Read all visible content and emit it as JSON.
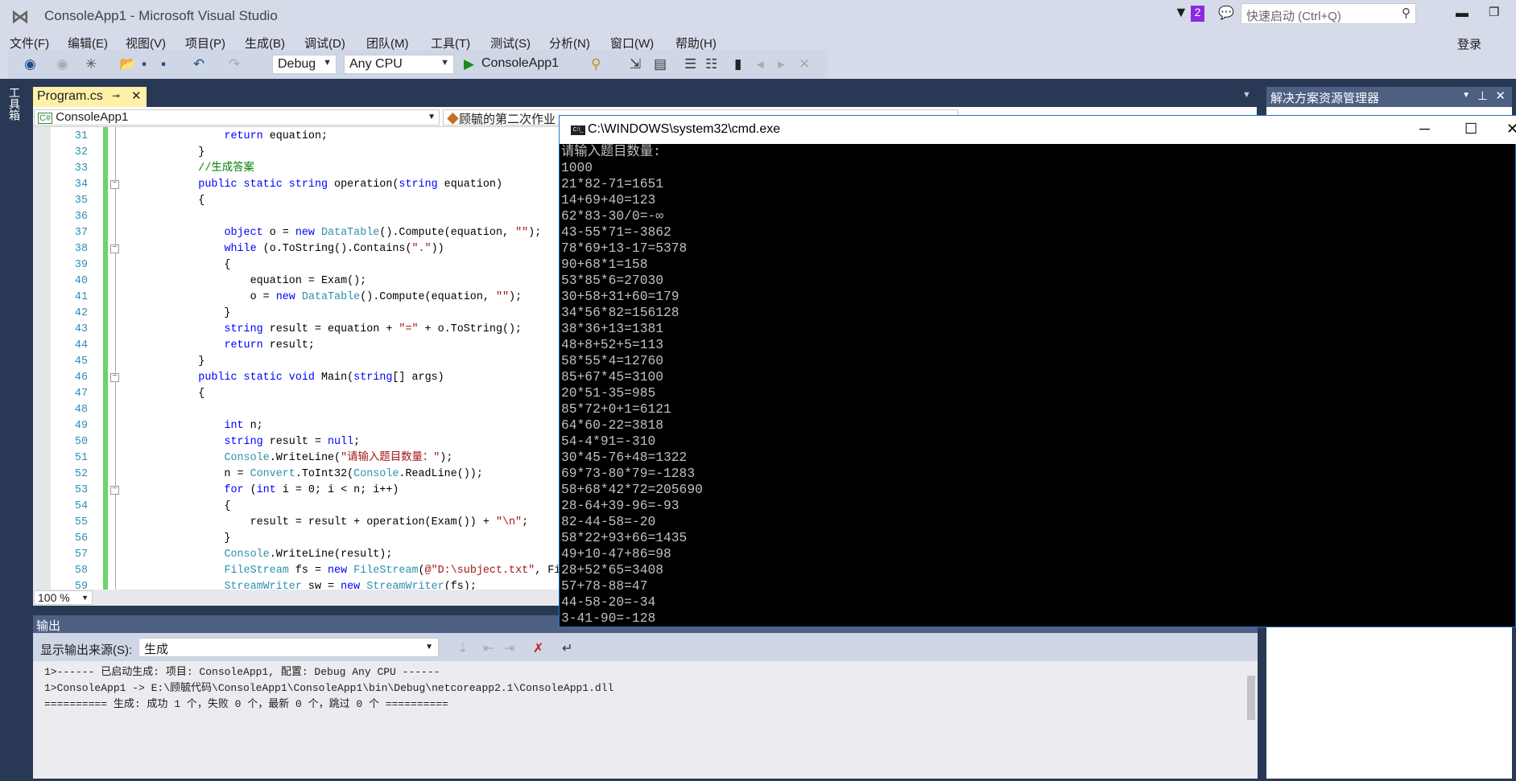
{
  "window": {
    "title": "ConsoleApp1 - Microsoft Visual Studio",
    "notification_count": "2",
    "quick_launch_placeholder": "快速启动 (Ctrl+Q)",
    "sign_in": "登录"
  },
  "menu": [
    "文件(F)",
    "编辑(E)",
    "视图(V)",
    "项目(P)",
    "生成(B)",
    "调试(D)",
    "团队(M)",
    "工具(T)",
    "测试(S)",
    "分析(N)",
    "窗口(W)",
    "帮助(H)"
  ],
  "toolbar": {
    "config": "Debug",
    "platform": "Any CPU",
    "start_target": "ConsoleApp1"
  },
  "toolbox_label": "工具箱",
  "editor": {
    "tab": "Program.cs",
    "project_dropdown": "ConsoleApp1",
    "class_dropdown": "顾毓的第二次作业",
    "zoom": "100 %",
    "lines": [
      {
        "n": "31",
        "t": [
          [
            "            ",
            "tx"
          ],
          [
            "return",
            "kw"
          ],
          [
            " equation;",
            "tx"
          ]
        ]
      },
      {
        "n": "32",
        "t": [
          [
            "        }",
            "tx"
          ]
        ]
      },
      {
        "n": "33",
        "t": [
          [
            "        //生成答案",
            "cm"
          ]
        ]
      },
      {
        "n": "34",
        "fold": true,
        "t": [
          [
            "        ",
            "tx"
          ],
          [
            "public static string",
            "kw"
          ],
          [
            " operation(",
            "tx"
          ],
          [
            "string",
            "kw"
          ],
          [
            " equation)",
            "tx"
          ]
        ]
      },
      {
        "n": "35",
        "t": [
          [
            "        {",
            "tx"
          ]
        ]
      },
      {
        "n": "36",
        "t": []
      },
      {
        "n": "37",
        "t": [
          [
            "            ",
            "tx"
          ],
          [
            "object",
            "kw"
          ],
          [
            " o = ",
            "tx"
          ],
          [
            "new",
            "kw"
          ],
          [
            " ",
            "tx"
          ],
          [
            "DataTable",
            "ty"
          ],
          [
            "().Compute(equation, ",
            "tx"
          ],
          [
            "\"\"",
            "st"
          ],
          [
            ");",
            "tx"
          ]
        ]
      },
      {
        "n": "38",
        "fold": true,
        "t": [
          [
            "            ",
            "tx"
          ],
          [
            "while",
            "kw"
          ],
          [
            " (o.ToString().Contains(",
            "tx"
          ],
          [
            "\".\"",
            "st"
          ],
          [
            "))",
            "tx"
          ]
        ]
      },
      {
        "n": "39",
        "t": [
          [
            "            {",
            "tx"
          ]
        ]
      },
      {
        "n": "40",
        "t": [
          [
            "                equation = Exam();",
            "tx"
          ]
        ]
      },
      {
        "n": "41",
        "t": [
          [
            "                o = ",
            "tx"
          ],
          [
            "new",
            "kw"
          ],
          [
            " ",
            "tx"
          ],
          [
            "DataTable",
            "ty"
          ],
          [
            "().Compute(equation, ",
            "tx"
          ],
          [
            "\"\"",
            "st"
          ],
          [
            ");",
            "tx"
          ]
        ]
      },
      {
        "n": "42",
        "t": [
          [
            "            }",
            "tx"
          ]
        ]
      },
      {
        "n": "43",
        "t": [
          [
            "            ",
            "tx"
          ],
          [
            "string",
            "kw"
          ],
          [
            " result = equation + ",
            "tx"
          ],
          [
            "\"=\"",
            "st"
          ],
          [
            " + o.ToString();",
            "tx"
          ]
        ]
      },
      {
        "n": "44",
        "t": [
          [
            "            ",
            "tx"
          ],
          [
            "return",
            "kw"
          ],
          [
            " result;",
            "tx"
          ]
        ]
      },
      {
        "n": "45",
        "t": [
          [
            "        }",
            "tx"
          ]
        ]
      },
      {
        "n": "46",
        "fold": true,
        "t": [
          [
            "        ",
            "tx"
          ],
          [
            "public static void",
            "kw"
          ],
          [
            " Main(",
            "tx"
          ],
          [
            "string",
            "kw"
          ],
          [
            "[] args)",
            "tx"
          ]
        ]
      },
      {
        "n": "47",
        "t": [
          [
            "        {",
            "tx"
          ]
        ]
      },
      {
        "n": "48",
        "t": []
      },
      {
        "n": "49",
        "t": [
          [
            "            ",
            "tx"
          ],
          [
            "int",
            "kw"
          ],
          [
            " n;",
            "tx"
          ]
        ]
      },
      {
        "n": "50",
        "t": [
          [
            "            ",
            "tx"
          ],
          [
            "string",
            "kw"
          ],
          [
            " result = ",
            "tx"
          ],
          [
            "null",
            "kw"
          ],
          [
            ";",
            "tx"
          ]
        ]
      },
      {
        "n": "51",
        "t": [
          [
            "            ",
            "tx"
          ],
          [
            "Console",
            "ty"
          ],
          [
            ".WriteLine(",
            "tx"
          ],
          [
            "\"请输入题目数量：\"",
            "st"
          ],
          [
            ");",
            "tx"
          ]
        ]
      },
      {
        "n": "52",
        "t": [
          [
            "            n = ",
            "tx"
          ],
          [
            "Convert",
            "ty"
          ],
          [
            ".ToInt32(",
            "tx"
          ],
          [
            "Console",
            "ty"
          ],
          [
            ".ReadLine());",
            "tx"
          ]
        ]
      },
      {
        "n": "53",
        "fold": true,
        "t": [
          [
            "            ",
            "tx"
          ],
          [
            "for",
            "kw"
          ],
          [
            " (",
            "tx"
          ],
          [
            "int",
            "kw"
          ],
          [
            " i = 0; i < n; i++)",
            "tx"
          ]
        ]
      },
      {
        "n": "54",
        "t": [
          [
            "            {",
            "tx"
          ]
        ]
      },
      {
        "n": "55",
        "t": [
          [
            "                result = result + operation(Exam()) + ",
            "tx"
          ],
          [
            "\"\\n\"",
            "st"
          ],
          [
            ";",
            "tx"
          ]
        ]
      },
      {
        "n": "56",
        "t": [
          [
            "            }",
            "tx"
          ]
        ]
      },
      {
        "n": "57",
        "t": [
          [
            "            ",
            "tx"
          ],
          [
            "Console",
            "ty"
          ],
          [
            ".WriteLine(result);",
            "tx"
          ]
        ]
      },
      {
        "n": "58",
        "t": [
          [
            "            ",
            "tx"
          ],
          [
            "FileStream",
            "ty"
          ],
          [
            " fs = ",
            "tx"
          ],
          [
            "new",
            "kw"
          ],
          [
            " ",
            "tx"
          ],
          [
            "FileStream",
            "ty"
          ],
          [
            "(",
            "tx"
          ],
          [
            "@\"D:\\subject.txt\"",
            "st"
          ],
          [
            ", Fi",
            "tx"
          ]
        ]
      },
      {
        "n": "59",
        "t": [
          [
            "            ",
            "tx"
          ],
          [
            "StreamWriter",
            "ty"
          ],
          [
            " sw = ",
            "tx"
          ],
          [
            "new",
            "kw"
          ],
          [
            " ",
            "tx"
          ],
          [
            "StreamWriter",
            "ty"
          ],
          [
            "(fs);",
            "tx"
          ]
        ]
      }
    ]
  },
  "output": {
    "title": "输出",
    "source_label": "显示输出来源(S):",
    "source_value": "生成",
    "lines": [
      "1>------ 已启动生成: 项目: ConsoleApp1, 配置: Debug Any CPU ------",
      "1>ConsoleApp1 -> E:\\顾毓代码\\ConsoleApp1\\ConsoleApp1\\bin\\Debug\\netcoreapp2.1\\ConsoleApp1.dll",
      "========== 生成: 成功 1 个，失败 0 个，最新 0 个，跳过 0 个 =========="
    ]
  },
  "solution_explorer": {
    "title": "解决方案资源管理器"
  },
  "cmd": {
    "title": "C:\\WINDOWS\\system32\\cmd.exe",
    "icon_text": "C:\\_",
    "lines": [
      "请输入题目数量:",
      "1000",
      "21*82-71=1651",
      "14+69+40=123",
      "62*83-30/0=-∞",
      "43-55*71=-3862",
      "78*69+13-17=5378",
      "90+68*1=158",
      "53*85*6=27030",
      "30+58+31+60=179",
      "34*56*82=156128",
      "38*36+13=1381",
      "48+8+52+5=113",
      "58*55*4=12760",
      "85+67*45=3100",
      "20*51-35=985",
      "85*72+0+1=6121",
      "64*60-22=3818",
      "54-4*91=-310",
      "30*45-76+48=1322",
      "69*73-80*79=-1283",
      "58+68*42*72=205690",
      "28-64+39-96=-93",
      "82-44-58=-20",
      "58*22+93+66=1435",
      "49+10-47+86=98",
      "28+52*65=3408",
      "57+78-88=47",
      "44-58-20=-34",
      "3-41-90=-128"
    ]
  }
}
